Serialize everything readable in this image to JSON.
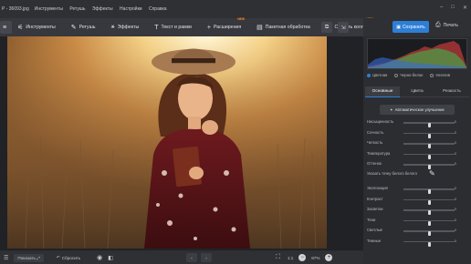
{
  "app": {
    "title": "Р - 36093.jpg"
  },
  "menu": [
    "Инструменты",
    "Ретушь",
    "Эффекты",
    "Настройки",
    "Справка"
  ],
  "window_controls": [
    "–",
    "□",
    "✕"
  ],
  "toolbar": {
    "items": [
      {
        "label": "Инструменты",
        "icon": "sliders-icon"
      },
      {
        "label": "Ретушь",
        "icon": "brush-icon"
      },
      {
        "label": "Эффекты",
        "icon": "magic-wand-icon"
      },
      {
        "label": "Текст и рамки",
        "icon": "text-icon"
      },
      {
        "label": "Расширения",
        "icon": "plus-icon",
        "badge": "NEW"
      },
      {
        "label": "Пакетная обработка",
        "icon": "batch-icon"
      },
      {
        "label": "Создать коллаж",
        "icon": "collage-icon",
        "badge": "NEW"
      }
    ]
  },
  "header": {
    "save_label": "Сохранить",
    "print_label": "Печать"
  },
  "panel": {
    "view_modes": [
      "Цветная",
      "Черно-белое",
      "Негатив"
    ],
    "tabs": [
      "Основные",
      "Цвета",
      "Резкость"
    ],
    "auto_label": "Автоматическое улучшение",
    "white_point_label": "Указать точку белого белого",
    "group1": [
      {
        "label": "Насыщенность",
        "value": "0",
        "level": 0.5
      },
      {
        "label": "Сочность",
        "value": "0",
        "level": 0.5
      },
      {
        "label": "Четкость",
        "value": "0",
        "level": 0.5
      },
      {
        "label": "Температура",
        "value": "0",
        "level": 0.5
      },
      {
        "label": "Оттенок",
        "value": "0",
        "level": 0.5
      }
    ],
    "group2": [
      {
        "label": "Экспозиция",
        "value": "0",
        "level": 0.5
      },
      {
        "label": "Контраст",
        "value": "0",
        "level": 0.5
      },
      {
        "label": "Засветки",
        "value": "0",
        "level": 0.5
      },
      {
        "label": "Тени",
        "value": "0",
        "level": 0.5
      },
      {
        "label": "Светлые",
        "value": "0",
        "level": 0.5
      },
      {
        "label": "Темные",
        "value": "0",
        "level": 0.5
      }
    ]
  },
  "bottom": {
    "show_label": "Показать",
    "reset_label": "Сбросить",
    "zoom_ratio": "1:1",
    "zoom_percent": "87%"
  },
  "colors": {
    "accent": "#2d7fd6",
    "badge": "#ff8a1e"
  }
}
